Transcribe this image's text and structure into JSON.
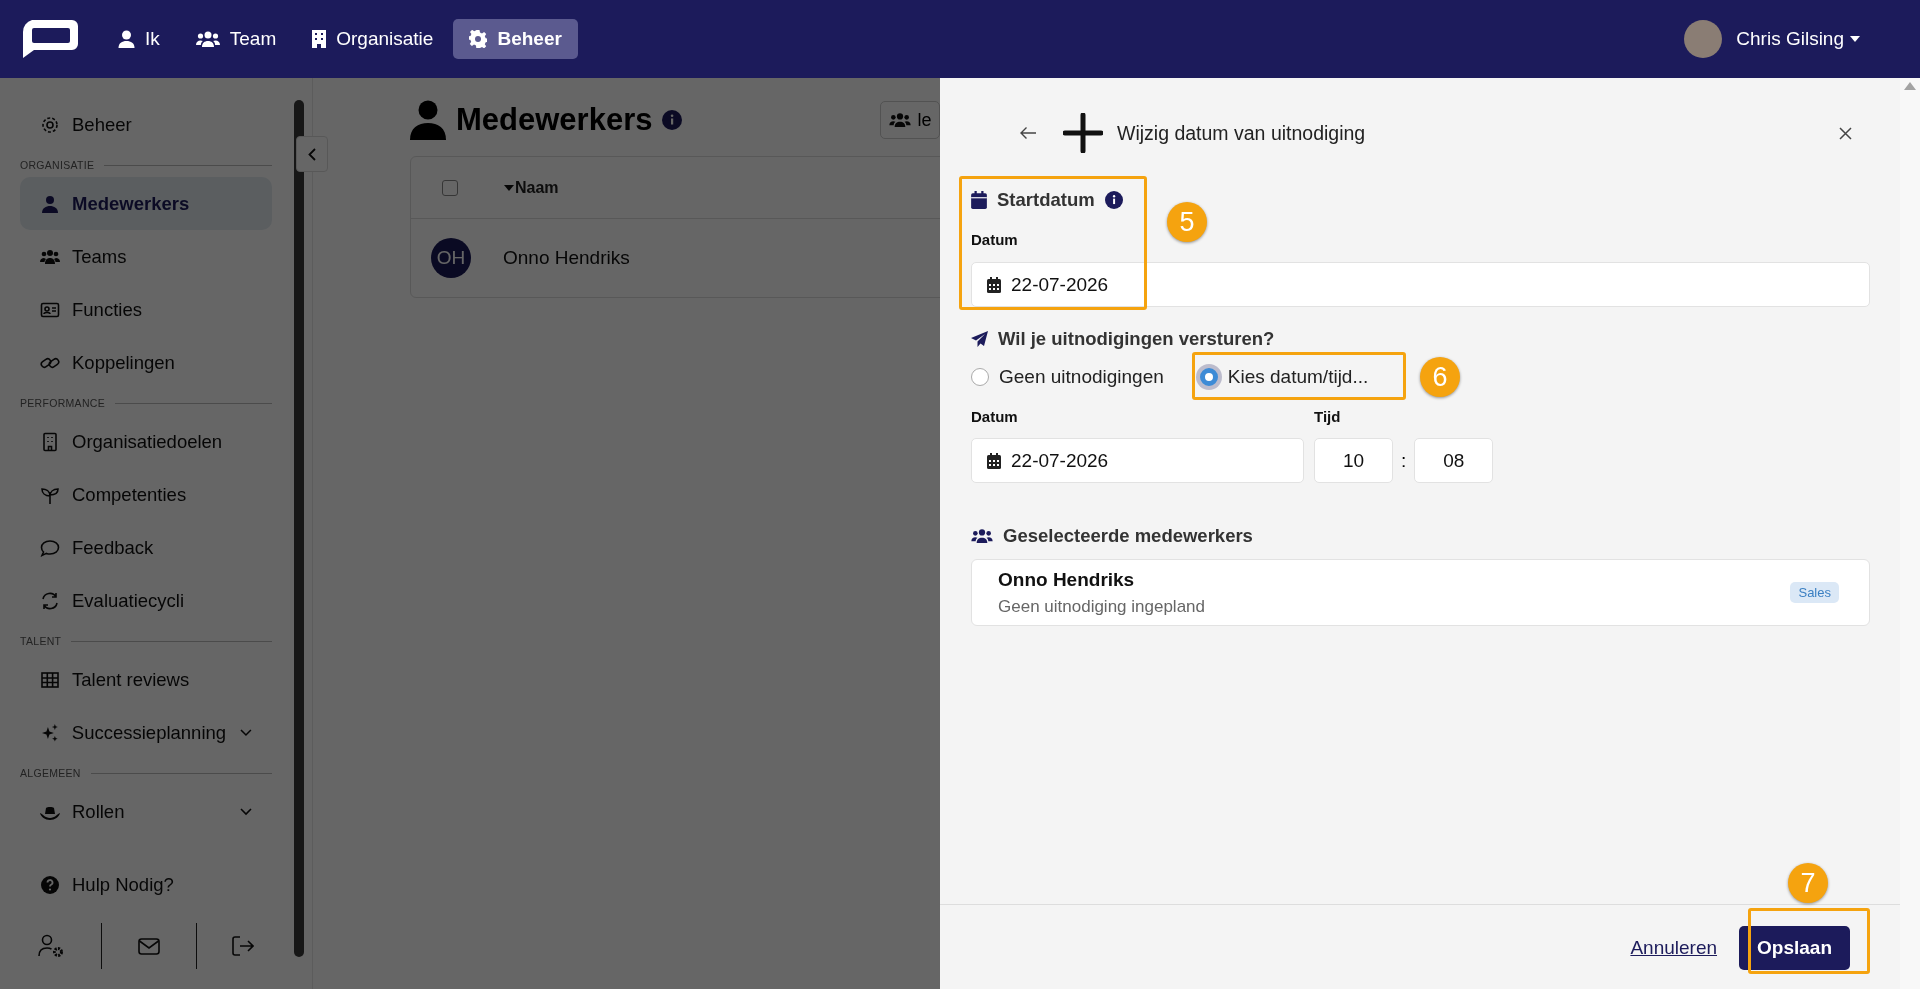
{
  "topbar": {
    "nav": [
      {
        "label": "Ik",
        "selected": false
      },
      {
        "label": "Team",
        "selected": false
      },
      {
        "label": "Organisatie",
        "selected": false
      },
      {
        "label": "Beheer",
        "selected": true
      }
    ],
    "user": {
      "name": "Chris Gilsing"
    }
  },
  "sidebar": {
    "sections": [
      {
        "items": [
          {
            "label": "Beheer",
            "selected": false
          }
        ]
      },
      {
        "heading": "ORGANISATIE",
        "items": [
          {
            "label": "Medewerkers",
            "selected": true
          },
          {
            "label": "Teams",
            "selected": false
          },
          {
            "label": "Functies",
            "selected": false
          },
          {
            "label": "Koppelingen",
            "selected": false
          }
        ]
      },
      {
        "heading": "PERFORMANCE",
        "items": [
          {
            "label": "Organisatiedoelen",
            "selected": false
          },
          {
            "label": "Competenties",
            "selected": false
          },
          {
            "label": "Feedback",
            "selected": false
          },
          {
            "label": "Evaluatiecycli",
            "selected": false
          }
        ]
      },
      {
        "heading": "TALENT",
        "items": [
          {
            "label": "Talent reviews",
            "selected": false
          },
          {
            "label": "Successieplanning",
            "selected": false,
            "expanded": false
          }
        ]
      },
      {
        "heading": "ALGEMEEN",
        "items": [
          {
            "label": "Rollen",
            "selected": false,
            "expanded": false
          }
        ]
      }
    ],
    "help": "Hulp Nodig?"
  },
  "main": {
    "title": "Medewerkers",
    "toolbar_button": "le",
    "table": {
      "select_all": {
        "checked": false
      },
      "columns": [
        "Naam"
      ],
      "rows": [
        {
          "initials": "OH",
          "name": "Onno Hendriks"
        }
      ]
    }
  },
  "panel": {
    "title": "Wijzig datum van uitnodiging",
    "start": {
      "heading": "Startdatum",
      "date_label": "Datum",
      "date": "22-07-2026"
    },
    "invite": {
      "heading": "Wil je uitnodigingen versturen?",
      "options": [
        {
          "label": "Geen uitnodigingen",
          "selected": false
        },
        {
          "label": "Kies datum/tijd...",
          "selected": true
        }
      ],
      "date_label": "Datum",
      "date": "22-07-2026",
      "time_label": "Tijd",
      "hour": "10",
      "separator": ":",
      "minute": "08"
    },
    "selected": {
      "heading": "Geselecteerde medewerkers",
      "employees": [
        {
          "name": "Onno Hendriks",
          "status": "Geen uitnodiging ingepland",
          "tag": "Sales"
        }
      ]
    },
    "footer": {
      "cancel": "Annuleren",
      "save": "Opslaan"
    }
  },
  "annotations": [
    "5",
    "6",
    "7"
  ]
}
